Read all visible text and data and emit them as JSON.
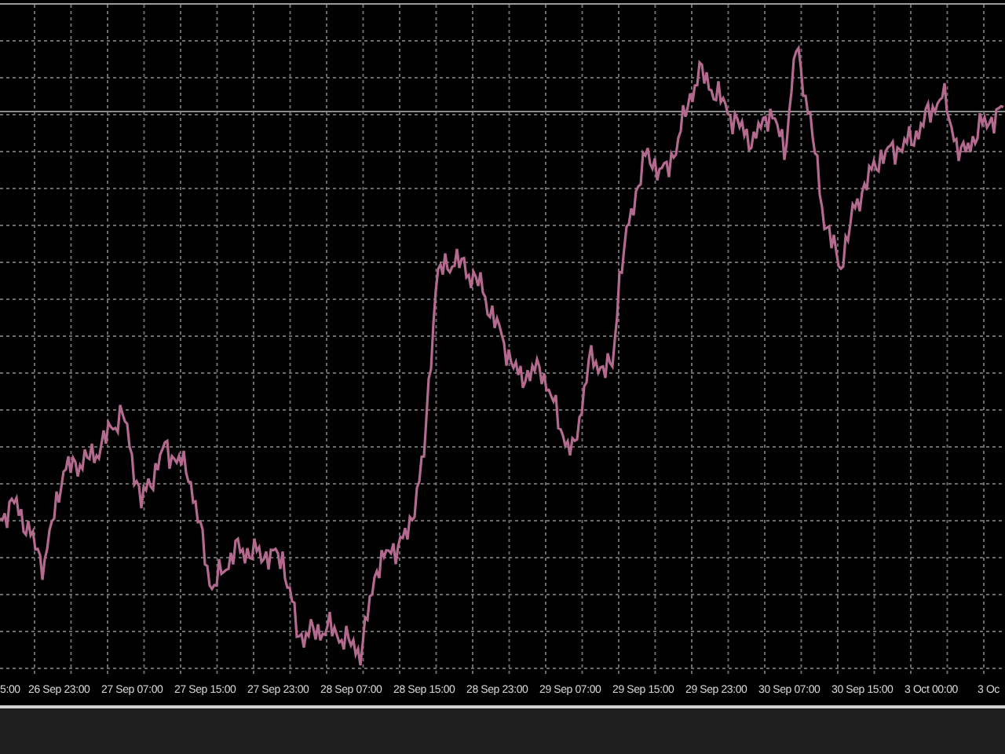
{
  "chart": {
    "time_labels": [
      "5:00",
      "26 Sep 23:00",
      "27 Sep 07:00",
      "27 Sep 15:00",
      "27 Sep 23:00",
      "28 Sep 07:00",
      "28 Sep 15:00",
      "28 Sep 23:00",
      "29 Sep 07:00",
      "29 Sep 15:00",
      "29 Sep 23:00",
      "30 Sep 07:00",
      "30 Sep 15:00",
      "3 Oct 00:00",
      "3 Oc"
    ]
  }
}
